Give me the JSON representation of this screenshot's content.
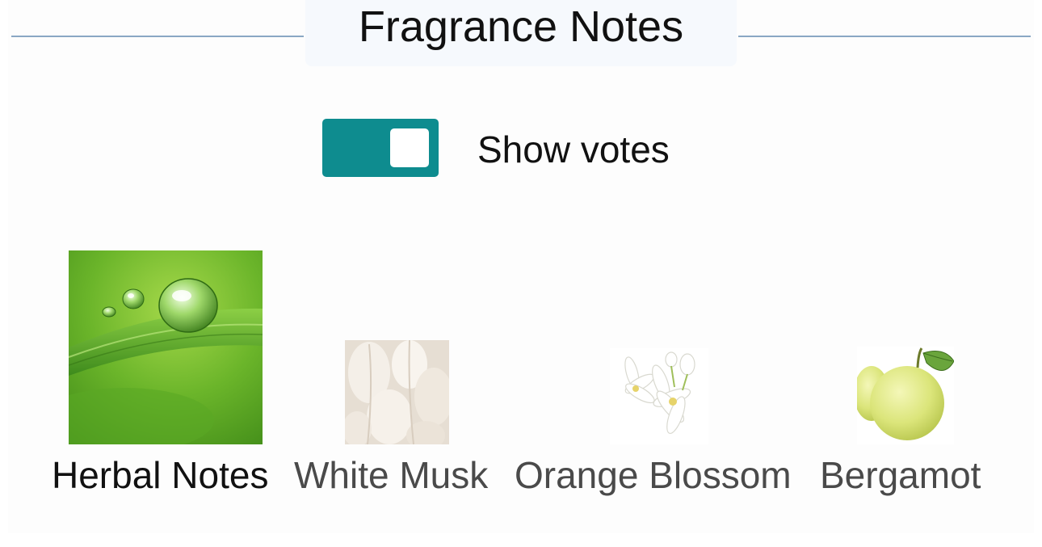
{
  "section": {
    "title": "Fragrance Notes"
  },
  "toggle": {
    "label": "Show votes",
    "state": "on",
    "color": "#0e8c8f"
  },
  "notes": [
    {
      "label": "Herbal Notes",
      "image": "water-drop-on-leaf-image",
      "emphasis": true
    },
    {
      "label": "White Musk",
      "image": "white-fluffy-grass-image",
      "emphasis": false
    },
    {
      "label": "Orange Blossom",
      "image": "white-flowers-image",
      "emphasis": false
    },
    {
      "label": "Bergamot",
      "image": "bergamot-fruit-image",
      "emphasis": false
    }
  ],
  "colors": {
    "rule": "#8aa8c4",
    "primary_text": "#111111",
    "secondary_text": "#4a4a4a"
  }
}
